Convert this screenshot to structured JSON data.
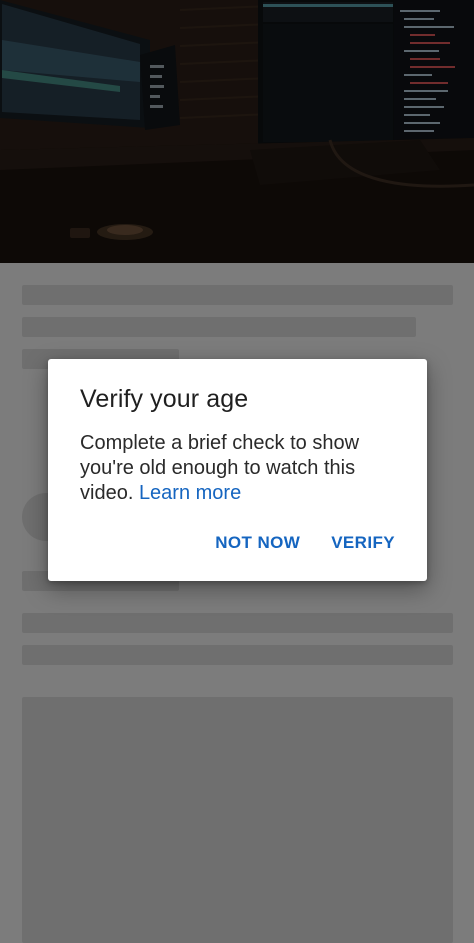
{
  "video": {
    "thumbnail": "dark-room-computer-monitors"
  },
  "dialog": {
    "title": "Verify your age",
    "body": "Complete a brief check to show you're old enough to watch this video.",
    "learn_more": "Learn more",
    "not_now_label": "NOT NOW",
    "verify_label": "VERIFY"
  },
  "colors": {
    "accent": "#1565c0",
    "dialog_bg": "#ffffff",
    "backdrop": "#7c7c7c",
    "skeleton": "#6f6f6f"
  }
}
